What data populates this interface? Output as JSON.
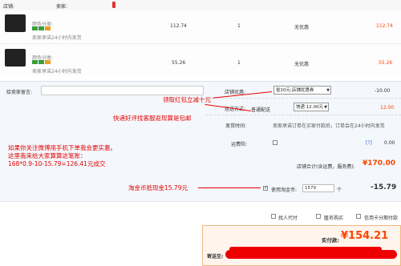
{
  "store": {
    "label": "店铺:",
    "name": "",
    "seller_label": "卖家:",
    "trust_tag": "",
    "badge": ""
  },
  "items": [
    {
      "title": "",
      "spec": "颜色分类:",
      "ship_note": "卖家承诺24小时内发货",
      "price": "112.74",
      "qty": "1",
      "discount": "无优惠",
      "subtotal": "112.74"
    },
    {
      "title": "",
      "spec": "颜色分类:",
      "ship_note": "卖家承诺24小时内发货",
      "price": "55.26",
      "qty": "1",
      "discount": "无优惠",
      "subtotal": "55.26"
    }
  ],
  "message": {
    "label": "给卖家留言:",
    "placeholder": ""
  },
  "coupon": {
    "label": "店铺优惠:",
    "value": "省10元:店铺优惠券",
    "amount": "-10.00"
  },
  "shipping": {
    "label": "运送方式:",
    "method": "普通配送",
    "option": "快递 12.00元",
    "amount": "12.00"
  },
  "delivery": {
    "label": "发货时间:",
    "text": "卖家承诺订单在买家付款后，订单会在24小时内发货"
  },
  "insurance": {
    "label": "运费险:",
    "text": "",
    "amount": "0.00"
  },
  "store_total": {
    "label": "店铺合计(含运费，服务费):",
    "value": "¥170.00"
  },
  "taojinbi": {
    "label": "使用淘金币:",
    "input": "1579",
    "unit": "个",
    "sub": "",
    "amount": "-15.79"
  },
  "options": [
    {
      "label": "找人代付"
    },
    {
      "label": "匿名购买"
    },
    {
      "label": "信用卡分期付款"
    }
  ],
  "final": {
    "label": "实付款:",
    "value": "¥154.21",
    "ship_to_label": "寄送至:"
  },
  "annotations": {
    "coupon": "领取红包立减十元",
    "shipping": "快递好评找客服返现算是包邮",
    "explain_line1": "如果你关注微博用手机下单我会更实惠。",
    "explain_line2": "这里我来给大家算算这笔账：",
    "explain_line3": "168*0.9-10-15.79=126.41元成交",
    "taojinbi": "淘金币抵现金15.79元"
  }
}
